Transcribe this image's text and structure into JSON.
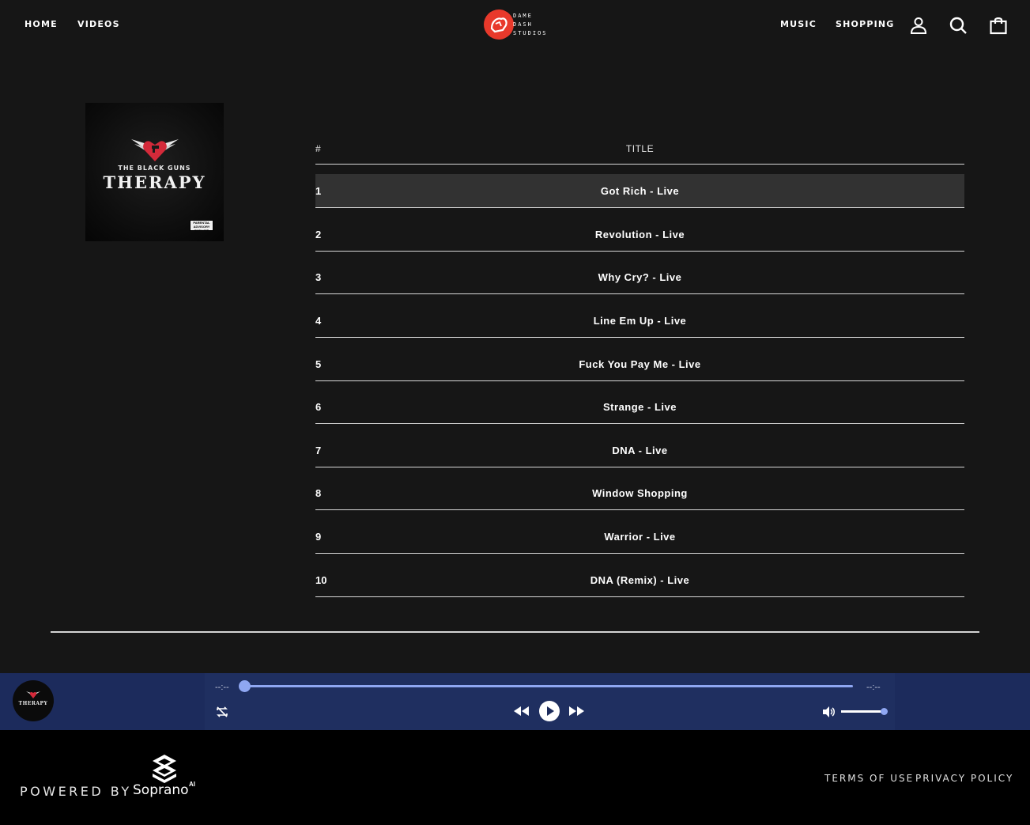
{
  "header": {
    "nav_left": [
      "HOME",
      "VIDEOS"
    ],
    "nav_right": [
      "MUSIC",
      "SHOPPING"
    ],
    "logo_lines": [
      "DAME",
      "DASH",
      "STUDIOS"
    ]
  },
  "album": {
    "cover_subtitle": "THE BLACK GUNS",
    "cover_title": "THERAPY",
    "advisory": "PARENTAL ADVISORY EXPLICIT CONTENT"
  },
  "tracklist": {
    "header_num": "#",
    "header_title": "TITLE",
    "active_index": 0,
    "tracks": [
      {
        "num": "1",
        "title": "Got Rich - Live"
      },
      {
        "num": "2",
        "title": "Revolution - Live"
      },
      {
        "num": "3",
        "title": "Why Cry? - Live"
      },
      {
        "num": "4",
        "title": "Line Em Up - Live"
      },
      {
        "num": "5",
        "title": "Fuck You Pay Me - Live"
      },
      {
        "num": "6",
        "title": "Strange - Live"
      },
      {
        "num": "7",
        "title": "DNA - Live"
      },
      {
        "num": "8",
        "title": "Window Shopping"
      },
      {
        "num": "9",
        "title": "Warrior - Live"
      },
      {
        "num": "10",
        "title": "DNA (Remix) - Live"
      }
    ]
  },
  "player": {
    "thumb_text": "THERAPY",
    "elapsed": "--:--",
    "duration": "--:--",
    "progress": 0,
    "volume": 1.0
  },
  "footer": {
    "powered_by": "POWERED BY",
    "brand": "Soprano",
    "brand_sup": "AI",
    "terms": "TERMS OF USE",
    "privacy": "PRIVACY POLICY"
  },
  "colors": {
    "background": "#161616",
    "player_bg": "#1c2b5c",
    "accent": "#8fa7f2",
    "logo_red": "#e8392b"
  },
  "icons": [
    "user-icon",
    "search-icon",
    "bag-icon",
    "repeat-off-icon",
    "rewind-icon",
    "play-icon",
    "fast-forward-icon",
    "volume-icon"
  ]
}
